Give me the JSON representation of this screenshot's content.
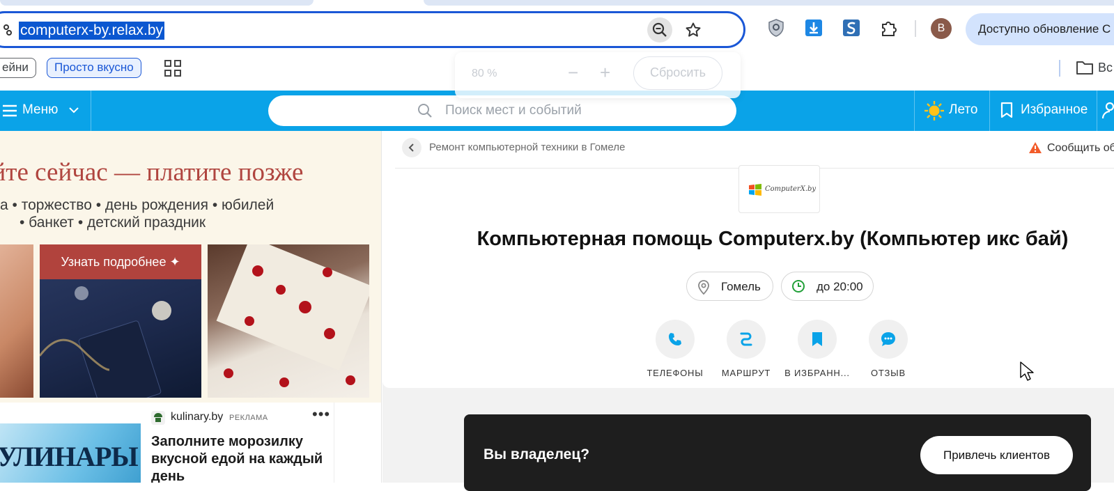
{
  "browser": {
    "url": "computerx-by.relax.by",
    "avatar_letter": "B",
    "update_label": "Доступно обновление C",
    "bookmarks": [
      "ейни",
      "Просто вкусно"
    ],
    "bookmark_folder_label": "Вс",
    "icons": {
      "site_settings": "tune-icon",
      "zoom": "zoom-out-icon",
      "bookmark_star": "star-icon",
      "extensions": [
        "shield-icon",
        "download-icon",
        "s-app-icon",
        "puzzle-icon"
      ],
      "apps": "apps-grid-icon",
      "folder": "folder-icon"
    },
    "zoom_popup": {
      "percent": "80 %",
      "minus": "−",
      "plus": "+",
      "reset_label": "Сбросить"
    },
    "colors": {
      "accent": "#0b57d0",
      "update_pill": "#d3e3fd"
    }
  },
  "site_header": {
    "menu_label": "Меню",
    "search_placeholder": "Поиск мест и событий",
    "season_label": "Лето",
    "favorites_label": "Избранное",
    "colors": {
      "background": "#0aa3e8"
    }
  },
  "left_ad": {
    "headline": "уйте сейчас — платите позже",
    "subline1": "а • торжество • день рождения • юбилей",
    "subline2": "• банкет • детский праздник",
    "cta_label": "Узнать подробнее ✦",
    "card": {
      "image_text": "УЛИНАРЫ",
      "source": "kulinary.by",
      "tag": "РЕКЛАМА",
      "more": "•••",
      "title": "Заполните морозилку вкусной едой на каждый день"
    },
    "colors": {
      "headline": "#b0453f",
      "cta": "#b1433d",
      "banner_bg": "#fbf6e9"
    }
  },
  "business": {
    "breadcrumb": "Ремонт компьютерной техники в Гомеле",
    "report_label": "Сообщить об",
    "logo_text": "ComputerX.by",
    "title": "Компьютерная помощь Computerx.by (Компьютер икс бай)",
    "city": "Гомель",
    "hours": "до 20:00",
    "actions": [
      {
        "label": "ТЕЛЕФОНЫ",
        "icon": "phone-icon"
      },
      {
        "label": "МАРШРУТ",
        "icon": "route-icon"
      },
      {
        "label": "В ИЗБРАНН...",
        "icon": "bookmark-icon"
      },
      {
        "label": "ОТЗЫВ",
        "icon": "chat-icon"
      }
    ],
    "colors": {
      "icon_accent": "#0aa3e8",
      "hours_icon": "#21a038",
      "report_icon": "#f25c2a"
    }
  },
  "owner": {
    "question": "Вы владелец?",
    "button_label": "Привлечь клиентов"
  }
}
